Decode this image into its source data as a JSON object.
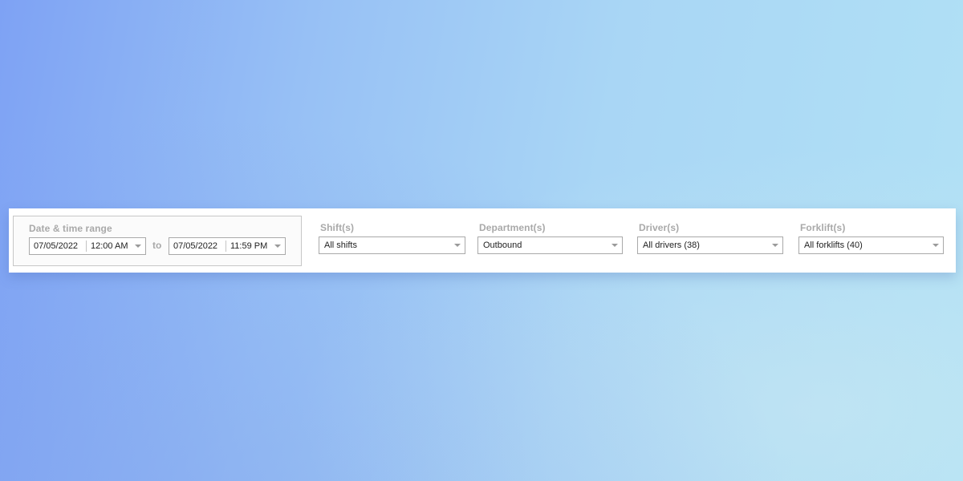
{
  "filters": {
    "date_range": {
      "label": "Date & time range",
      "from": {
        "date": "07/05/2022",
        "time": "12:00 AM"
      },
      "separator": "to",
      "to": {
        "date": "07/05/2022",
        "time": "11:59 PM"
      }
    },
    "shifts": {
      "label": "Shift(s)",
      "value": "All shifts"
    },
    "departments": {
      "label": "Department(s)",
      "value": "Outbound"
    },
    "drivers": {
      "label": "Driver(s)",
      "value": "All drivers (38)"
    },
    "forklifts": {
      "label": "Forklift(s)",
      "value": "All forklifts (40)"
    }
  },
  "icons": {
    "dropdown": "chevron-down-icon"
  },
  "colors": {
    "background_start": "#7ea2f4",
    "background_end": "#b1e1f5",
    "label": "#a9a9a9",
    "field_border": "#a9a9a9",
    "panel": "#ffffff"
  }
}
